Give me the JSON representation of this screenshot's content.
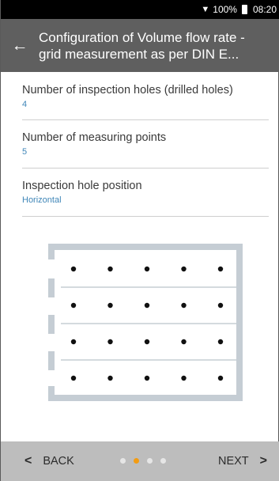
{
  "status": {
    "battery_text": "100%",
    "time": "08:20"
  },
  "appbar": {
    "title_line1": "Configuration of Volume flow rate -",
    "title_line2": "grid measurement as per DIN E..."
  },
  "settings": [
    {
      "label": "Number of inspection holes (drilled holes)",
      "value": "4"
    },
    {
      "label": "Number of measuring points",
      "value": "5"
    },
    {
      "label": "Inspection hole position",
      "value": "Horizontal"
    }
  ],
  "grid": {
    "holes": 4,
    "points": 5,
    "position": "Horizontal"
  },
  "nav": {
    "back_label": "BACK",
    "next_label": "NEXT",
    "page_count": 4,
    "current_page": 2
  },
  "colors": {
    "accent": "#f39c12",
    "value_text": "#3f86b8",
    "appbar": "#5f5f5f",
    "bottombar": "#bdbdbd",
    "diagram_frame": "#c5cdd4"
  },
  "icons": {
    "back": "arrow-left-icon",
    "wifi": "wifi-icon",
    "battery": "battery-icon",
    "prev": "chevron-left-icon",
    "next": "chevron-right-icon"
  }
}
